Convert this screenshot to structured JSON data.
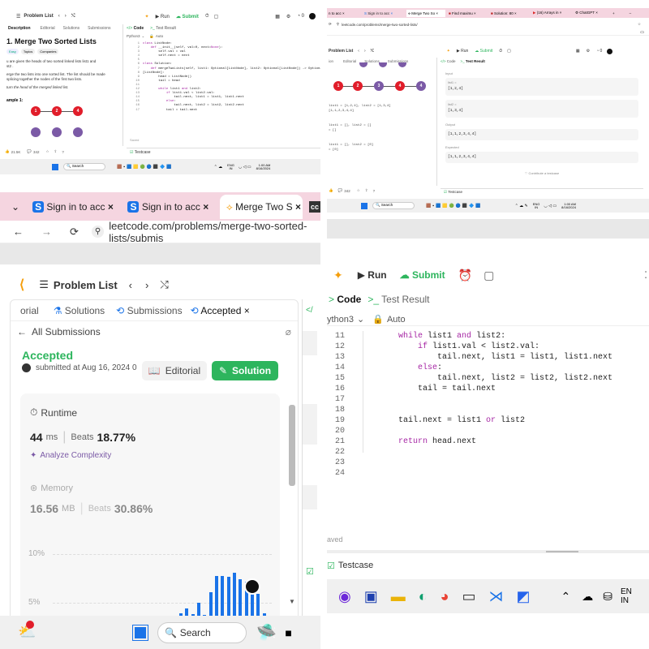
{
  "q1": {
    "header": {
      "problem_list": "Problem List",
      "run": "Run",
      "submit": "Submit"
    },
    "tabs": [
      "Description",
      "Editorial",
      "Solutions",
      "Submissions"
    ],
    "title": "1. Merge Two Sorted Lists",
    "chips": [
      "Easy",
      "Topics",
      "Companies"
    ],
    "desc": [
      "u are given the heads of two sorted linked lists  list1  and",
      "st2 .",
      "erge the two lists into one sorted list. The list should be made",
      "splicing together the nodes of the first two lists.",
      "turn the head of the merged linked list."
    ],
    "example": "ample 1:",
    "nodes": [
      "1",
      "2",
      "4"
    ],
    "footer": {
      "likes": "21.5K",
      "comments": "342"
    },
    "code_tab": "Code",
    "result_tab": "Test Result",
    "lang": "Python3",
    "auto": "Auto",
    "line_numbers": [
      "1",
      "2",
      "3",
      "4",
      "5",
      "6",
      "7",
      "8",
      "9",
      "10",
      "11",
      "12",
      "13",
      "14",
      "15",
      "16",
      "17"
    ],
    "code": [
      "class ListNode:",
      "    def __init__(self, val=0, next=None):",
      "        self.val = val",
      "        self.next = next",
      "",
      "class Solution:",
      "    def mergeTwoLists(self, list1: Optional[ListNode], list2: Optional[ListNode]) -> Optional",
      "[ListNode]:",
      "        head = ListNode()",
      "        tail = head",
      "",
      "        while list1 and list2:",
      "            if list1.val < list2.val:",
      "                tail.next, list1 = list1, list1.next",
      "            else:",
      "                tail.next, list2 = list2, list2.next",
      "            tail = tail.next"
    ],
    "saved": "Saved",
    "testcase": "Testcase",
    "search": "Search",
    "tray": {
      "lang": "ENG",
      "region": "IN",
      "time": "1:00 AM",
      "date": "8/16/2024"
    }
  },
  "q2": {
    "browser_tabs": [
      "n to acc",
      "Sign in to acc",
      "Merge Two So",
      "Find maximu",
      "Solution: 80",
      "(16) Arrays in",
      "ChatGPT"
    ],
    "url": "leetcode.com/problems/merge-two-sorted-lists/",
    "header": {
      "problem_list": "Problem List",
      "run": "Run",
      "submit": "Submit"
    },
    "tabs": [
      "ion",
      "Editorial",
      "Solutions",
      "Submissions"
    ],
    "code_tab": "Code",
    "result_tab": "Test Result",
    "left_code": [
      "list1 = [1,2,4], list2 = [1,3,4]",
      "[1,1,2,3,4,4]",
      "",
      "list1 = [], list2 = []",
      "= []",
      "",
      "list1 = [], list2 = [0]",
      "= [0]"
    ],
    "left_nodes": [
      "1",
      "2",
      "3",
      "4"
    ],
    "input_label": "Input",
    "list1_label": "list1 =",
    "list1_value": "[1,2,4]",
    "list2_label": "list2 =",
    "list2_value": "[1,3,4]",
    "output_label": "Output",
    "output_value": "[1,1,2,3,4,4]",
    "expected_label": "Expected",
    "expected_value": "[1,1,2,3,4,4]",
    "contribute": "Contribute a testcase",
    "footer": {
      "comments": "342"
    },
    "testcase": "Testcase",
    "search": "Search",
    "tray": {
      "lang": "ENG",
      "region": "IN",
      "time": "1:00 AM",
      "date": "8/16/2024"
    }
  },
  "q3": {
    "browser_tabs": [
      "Sign in to acc",
      "Sign in to acc",
      "Merge Two S"
    ],
    "url": "leetcode.com/problems/merge-two-sorted-lists/submis",
    "problem_list": "Problem List",
    "tabs": [
      "orial",
      "Solutions",
      "Submissions",
      "Accepted"
    ],
    "all_submissions": "All Submissions",
    "status": "Accepted",
    "submitted": "submitted at Aug 16, 2024 0",
    "editorial_btn": "Editorial",
    "solution_btn": "Solution",
    "runtime_label": "Runtime",
    "runtime_value": "44",
    "runtime_unit": "ms",
    "beats_label": "Beats",
    "runtime_beats": "18.77%",
    "analyze": "Analyze Complexity",
    "memory_label": "Memory",
    "memory_value": "16.56",
    "memory_unit": "MB",
    "memory_beats": "30.86%",
    "axis_labels": [
      "10%",
      "5%"
    ],
    "search": "Search",
    "bar_heights": [
      0.22,
      0.3,
      0.2,
      0.42,
      0.18,
      0.62,
      0.92,
      0.92,
      0.9,
      0.98,
      0.86,
      0.82,
      0.66,
      0.58,
      0.22
    ]
  },
  "q4": {
    "run": "Run",
    "submit": "Submit",
    "code_tab": "Code",
    "result_tab": "Test Result",
    "lang": "ython3",
    "auto": "Auto",
    "line_numbers": [
      "11",
      "12",
      "13",
      "14",
      "15",
      "16",
      "17",
      "18",
      "19",
      "20",
      "21",
      "22",
      "23",
      "24"
    ],
    "code": [
      "        while list1 and list2:",
      "            if list1.val < list2.val:",
      "                tail.next, list1 = list1, list1.next",
      "            else:",
      "                tail.next, list2 = list2, list2.next",
      "            tail = tail.next",
      "",
      "",
      "        tail.next = list1 or list2",
      "",
      "        return head.next",
      "",
      "",
      ""
    ],
    "saved": "aved",
    "testcase": "Testcase",
    "tray": {
      "lang": "EN",
      "region": "IN"
    }
  },
  "colors": {
    "green": "#2db55d",
    "red": "#e11d2a",
    "purple": "#7b5aa6",
    "blue": "#1a73e8",
    "code_kw": "#a626a4"
  }
}
